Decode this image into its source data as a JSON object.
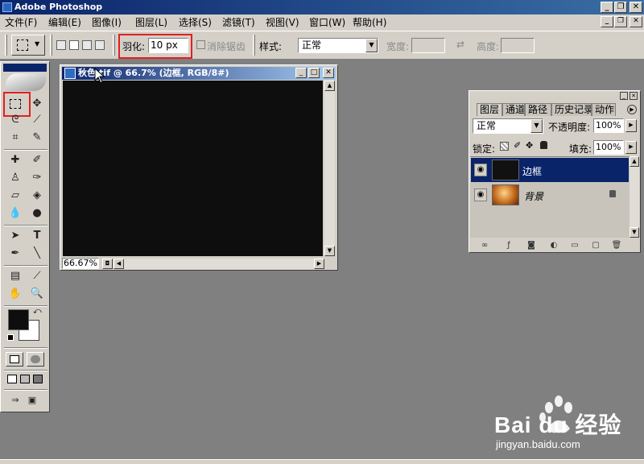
{
  "app": {
    "title": "Adobe Photoshop"
  },
  "menu": [
    "文件(F)",
    "编辑(E)",
    "图像(I)",
    "图层(L)",
    "选择(S)",
    "滤镜(T)",
    "视图(V)",
    "窗口(W)",
    "帮助(H)"
  ],
  "options_bar": {
    "feather_label": "羽化:",
    "feather_value": "10 px",
    "antialias_label": "消除锯齿",
    "style_label": "样式:",
    "style_value": "正常",
    "width_label": "宽度:",
    "height_label": "高度:"
  },
  "document": {
    "title": "秋色.tif @ 66.7% (边框, RGB/8#)",
    "zoom": "66.67%",
    "canvas_color": "#0e0e0e"
  },
  "layers_panel": {
    "tabs": [
      "图层",
      "通道",
      "路径",
      "历史记录",
      "动作"
    ],
    "blend_mode": "正常",
    "opacity_label": "不透明度:",
    "opacity_value": "100%",
    "lock_label": "锁定:",
    "fill_label": "填充:",
    "fill_value": "100%",
    "layers": [
      {
        "name": "边框",
        "selected": true
      },
      {
        "name": "背景",
        "selected": false
      }
    ]
  },
  "watermark": {
    "brand": "Bai du 经验",
    "url": "jingyan.baidu.com"
  },
  "colors": {
    "title_bar": "#0a246a",
    "chrome": "#d4d0c8",
    "workspace": "#808080",
    "highlight": "#e02020",
    "selected_layer": "#0a246a"
  }
}
